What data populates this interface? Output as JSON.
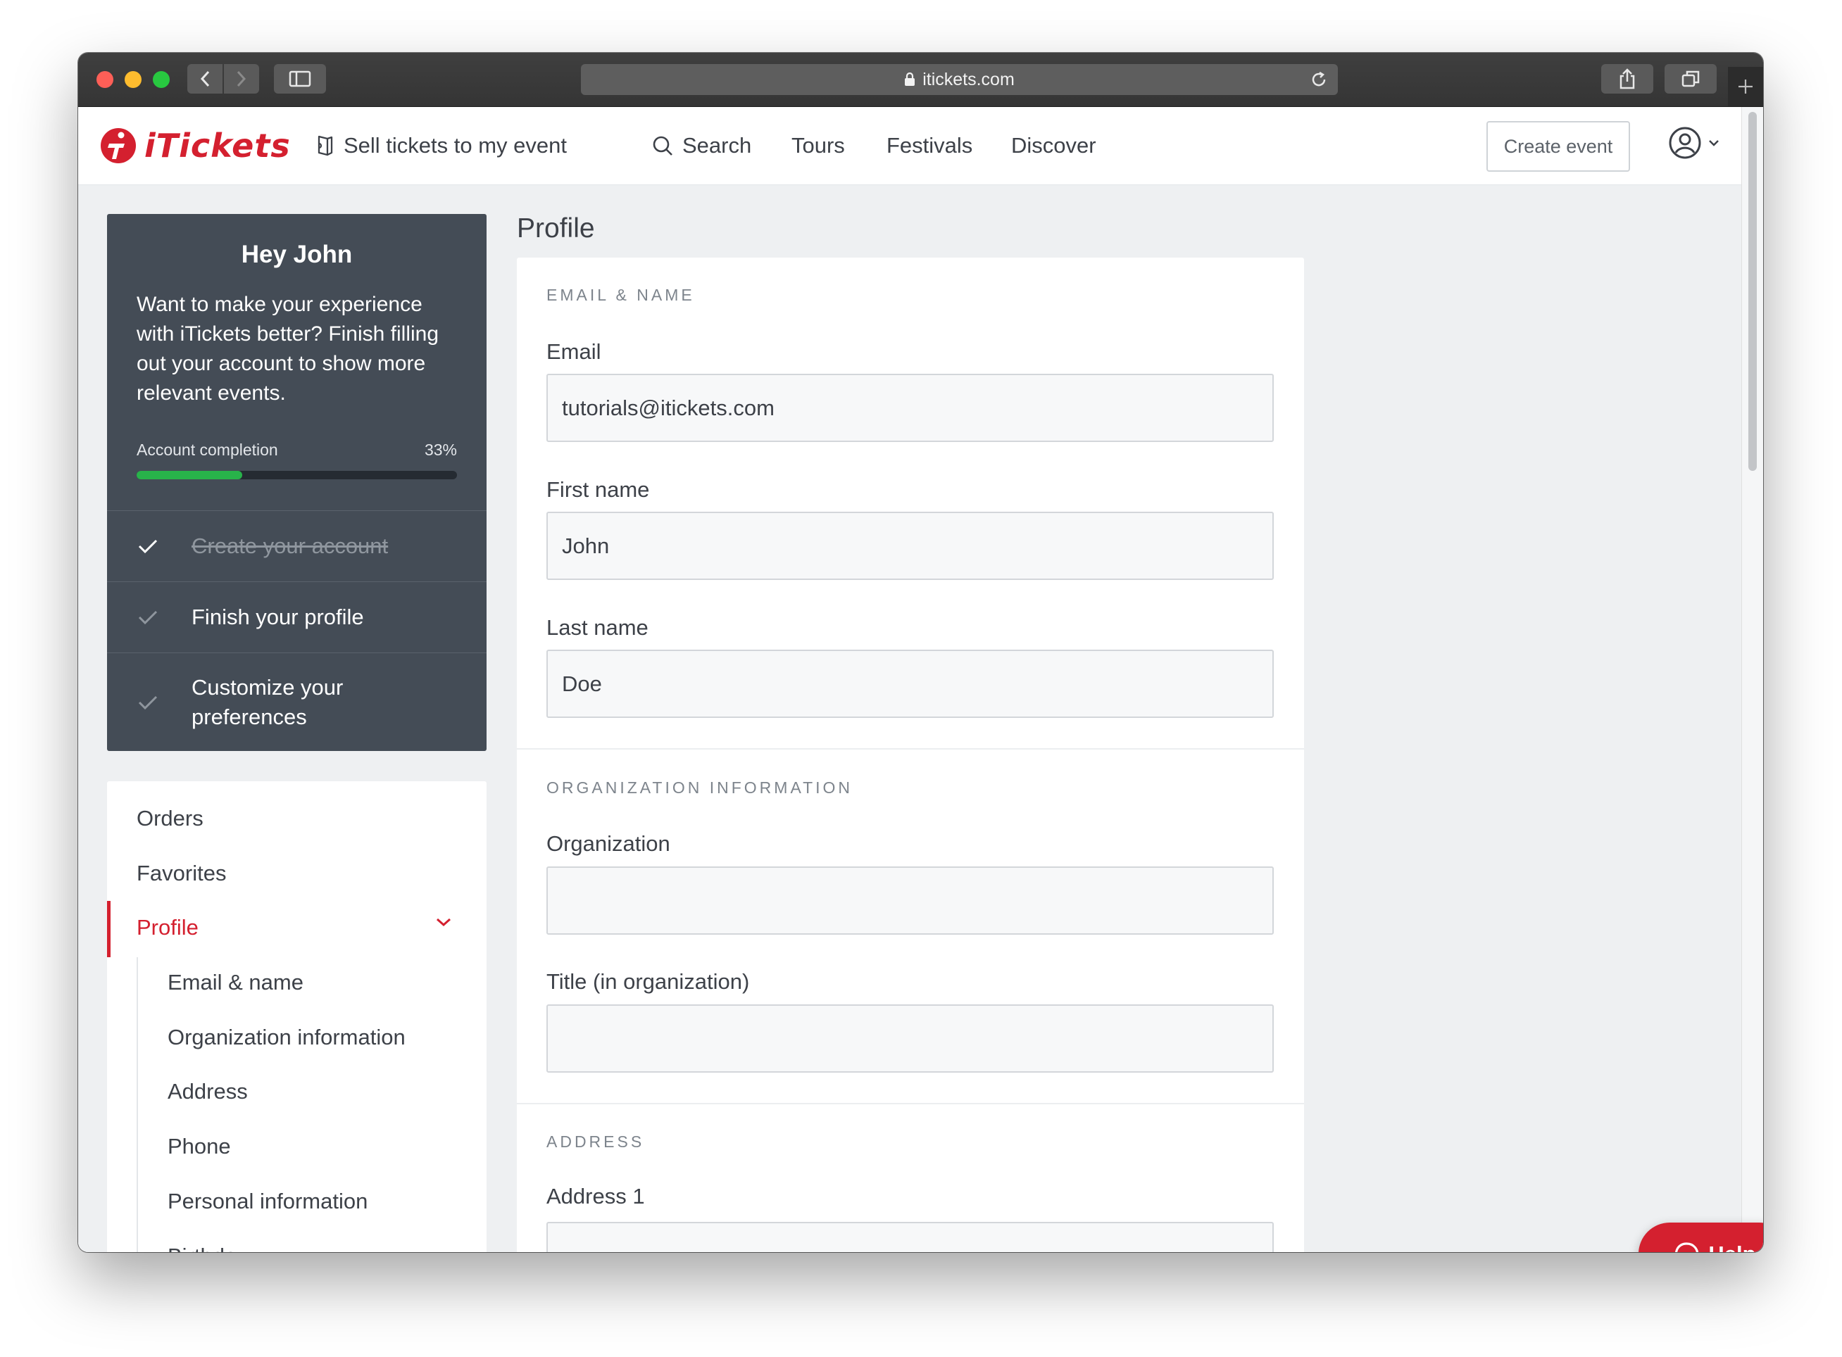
{
  "browser": {
    "url": "itickets.com"
  },
  "header": {
    "logo_text": "iTickets",
    "nav": {
      "sell": "Sell tickets to my event",
      "search": "Search",
      "tours": "Tours",
      "festivals": "Festivals",
      "discover": "Discover"
    },
    "create_event": "Create event"
  },
  "welcome": {
    "title": "Hey John",
    "message": "Want to make your experience with iTickets better? Finish filling out your account to show more relevant events.",
    "completion_label": "Account completion",
    "completion_pct_text": "33%",
    "completion_fraction": 0.33,
    "steps": [
      {
        "label": "Create your account",
        "done": true
      },
      {
        "label": "Finish your profile",
        "done": false
      },
      {
        "label": "Customize your preferences",
        "done": false
      }
    ]
  },
  "sidenav": {
    "orders": "Orders",
    "favorites": "Favorites",
    "profile": "Profile",
    "sub": [
      "Email & name",
      "Organization information",
      "Address",
      "Phone",
      "Personal information",
      "Birthday"
    ]
  },
  "page": {
    "title": "Profile"
  },
  "form": {
    "email_section": "EMAIL & NAME",
    "email_label": "Email",
    "email_value": "tutorials@itickets.com",
    "first_label": "First name",
    "first_value": "John",
    "last_label": "Last name",
    "last_value": "Doe",
    "org_section": "ORGANIZATION INFORMATION",
    "org_label": "Organization",
    "org_value": "",
    "title_label": "Title (in organization)",
    "title_value": "",
    "address_section": "ADDRESS",
    "address1_label": "Address 1"
  },
  "help": {
    "label": "Help"
  },
  "colors": {
    "brand": "#d4202f",
    "panel": "#444c56",
    "progress": "#28b34a"
  }
}
